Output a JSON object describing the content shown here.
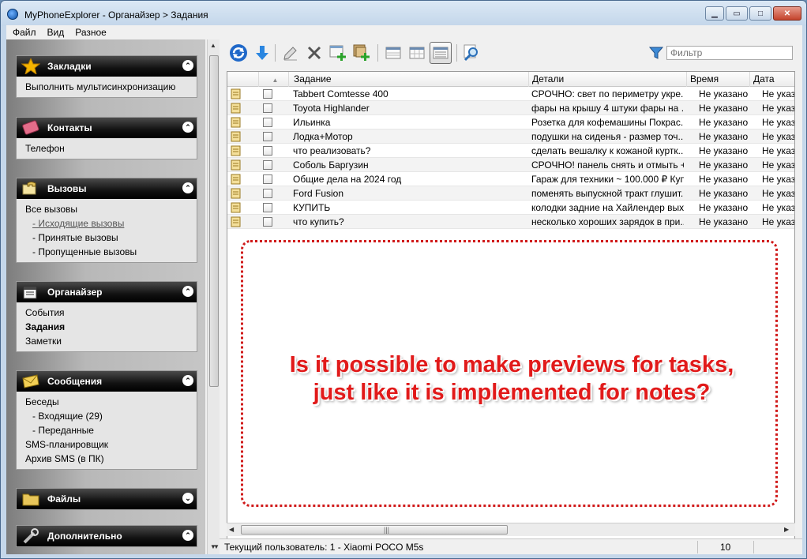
{
  "window": {
    "title": "MyPhoneExplorer -  Органайзер > Задания"
  },
  "menu": [
    "Файл",
    "Вид",
    "Разное"
  ],
  "sidebar": {
    "panels": [
      {
        "title": "Закладки",
        "icon": "star-icon",
        "collapse": "up",
        "items": [
          {
            "label": "Выполнить мультисинхронизацию",
            "style": "normal"
          }
        ]
      },
      {
        "title": "Контакты",
        "icon": "contacts-book-icon",
        "collapse": "up",
        "items": [
          {
            "label": "Телефон",
            "style": "normal"
          }
        ]
      },
      {
        "title": "Вызовы",
        "icon": "phone-calls-icon",
        "collapse": "up",
        "items": [
          {
            "label": "Все вызовы",
            "style": "normal"
          },
          {
            "label": "-  Исходящие вызовы",
            "style": "link"
          },
          {
            "label": "-  Принятые вызовы",
            "style": "sub"
          },
          {
            "label": "-  Пропущенные вызовы",
            "style": "sub"
          }
        ]
      },
      {
        "title": "Органайзер",
        "icon": "organizer-icon",
        "collapse": "up",
        "items": [
          {
            "label": "События",
            "style": "normal"
          },
          {
            "label": "Задания",
            "style": "bold"
          },
          {
            "label": "Заметки",
            "style": "normal"
          }
        ]
      },
      {
        "title": "Сообщения",
        "icon": "envelope-icon",
        "collapse": "up",
        "items": [
          {
            "label": "Беседы",
            "style": "normal"
          },
          {
            "label": "-  Входящие (29)",
            "style": "sub"
          },
          {
            "label": "-  Переданные",
            "style": "sub"
          },
          {
            "label": "SMS-планировщик",
            "style": "normal"
          },
          {
            "label": "Архив SMS (в ПК)",
            "style": "normal"
          }
        ]
      },
      {
        "title": "Файлы",
        "icon": "folder-icon",
        "collapse": "down",
        "items": []
      },
      {
        "title": "Дополнительно",
        "icon": "wrench-icon",
        "collapse": "up",
        "items": []
      }
    ]
  },
  "toolbar": {
    "buttons": [
      "refresh-icon",
      "download-icon",
      "edit-icon",
      "delete-icon",
      "add-icon",
      "add-multiple-icon",
      "view-grid-1-icon",
      "view-grid-2-icon",
      "view-list-icon",
      "find-icon"
    ],
    "filter_placeholder": "Фильтр"
  },
  "table": {
    "columns": [
      "Задание",
      "Детали",
      "Время",
      "Дата"
    ],
    "rows": [
      {
        "task": "Tabbert Comtesse 400",
        "details": "СРОЧНО: свет по периметру укре...",
        "time": "Не указано",
        "date": "Не указ"
      },
      {
        "task": "Toyota Highlander",
        "details": "фары на крышу 4 штуки фары на ...",
        "time": "Не указано",
        "date": "Не указ"
      },
      {
        "task": "Ильинка",
        "details": "Розетка для кофемашины Покрас...",
        "time": "Не указано",
        "date": "Не указ"
      },
      {
        "task": "Лодка+Мотор",
        "details": "подушки на сиденья - размер точ...",
        "time": "Не указано",
        "date": "Не указ"
      },
      {
        "task": "что реализовать?",
        "details": "сделать вешалку к кожаной куртк...",
        "time": "Не указано",
        "date": "Не указ"
      },
      {
        "task": "Соболь Баргузин",
        "details": "СРОЧНО! панель снять и отмыть +...",
        "time": "Не указано",
        "date": "Не указ"
      },
      {
        "task": "Общие дела на 2024 год",
        "details": "Гараж для техники ~ 100.000 ₽ Куп...",
        "time": "Не указано",
        "date": "Не указ"
      },
      {
        "task": "Ford Fusion",
        "details": "поменять выпускной тракт глушит...",
        "time": "Не указано",
        "date": "Не указ"
      },
      {
        "task": "КУПИТЬ",
        "details": "колодки задние на Хайлендер вых...",
        "time": "Не указано",
        "date": "Не указ"
      },
      {
        "task": "что купить?",
        "details": "несколько хороших зарядок в при...",
        "time": "Не указано",
        "date": "Не указ"
      }
    ]
  },
  "annotation": {
    "line1": "Is it possible to make previews for tasks,",
    "line2": "just like it is implemented for notes?",
    "color": "#e11a1a"
  },
  "status": {
    "user": "Текущий пользователь: 1 - Xiaomi POCO M5s",
    "count": "10"
  }
}
